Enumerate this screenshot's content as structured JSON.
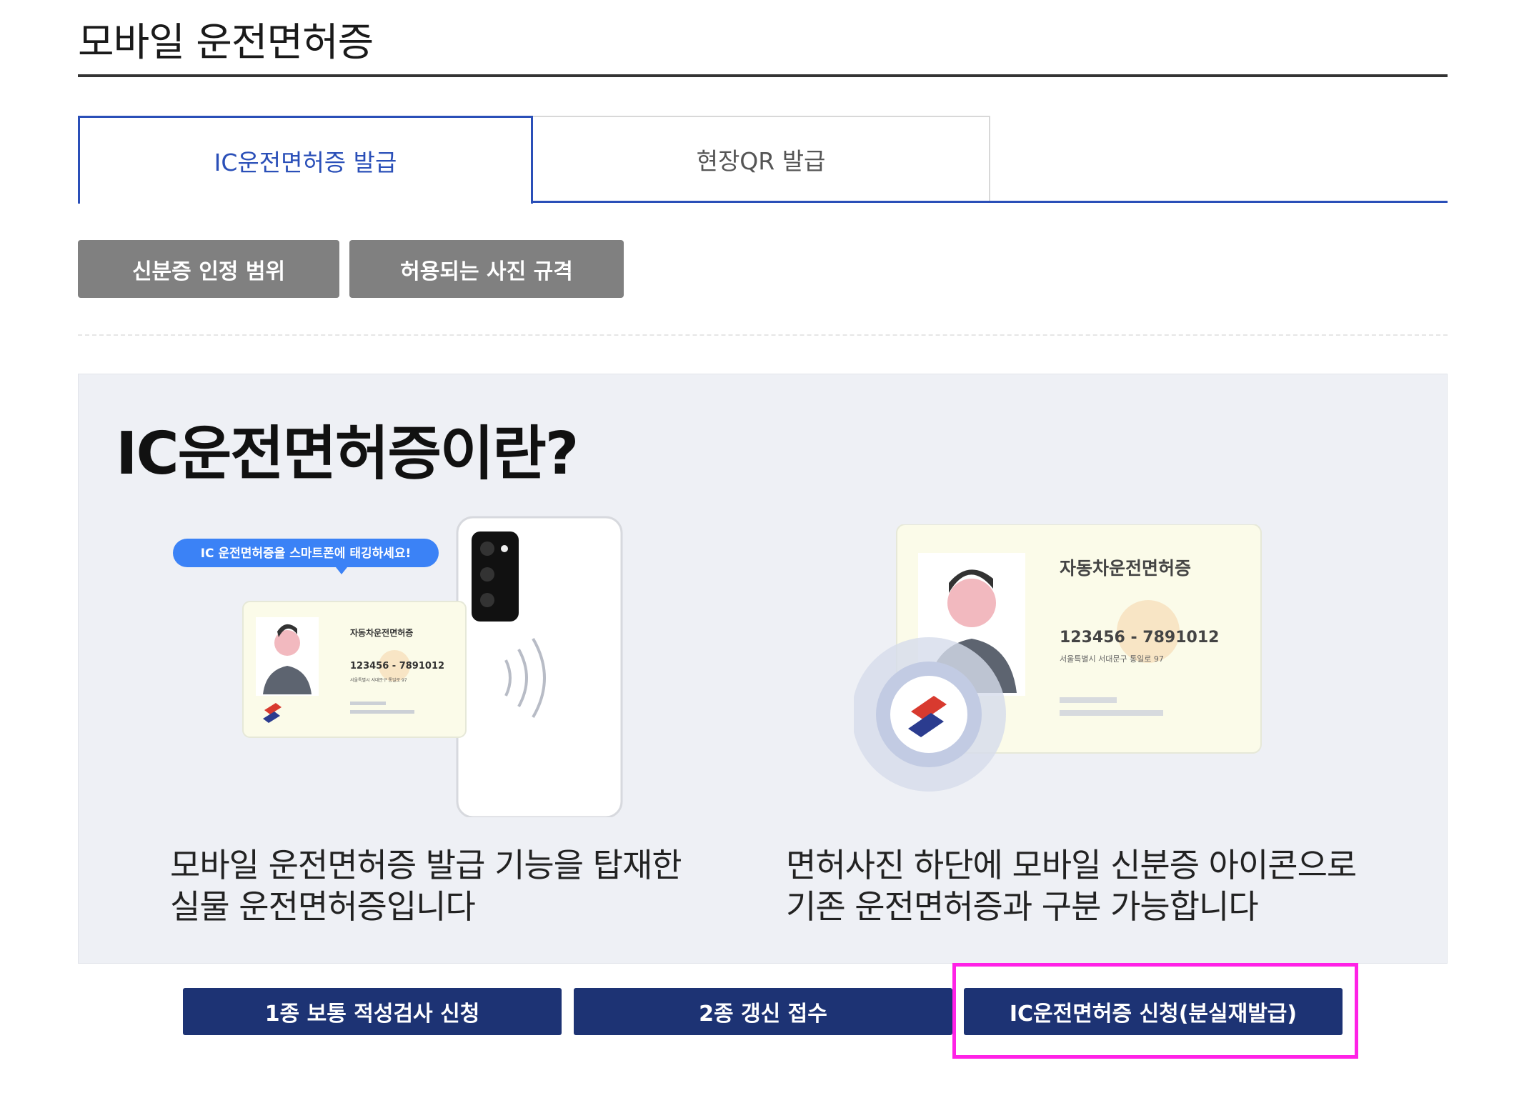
{
  "header": {
    "title": "모바일 운전면허증"
  },
  "tabs": [
    {
      "label": "IC운전면허증 발급",
      "active": true
    },
    {
      "label": "현장QR 발급",
      "active": false
    }
  ],
  "info_buttons": {
    "id_scope": "신분증 인정 범위",
    "photo_spec": "허용되는 사진 규격"
  },
  "info": {
    "heading": "IC운전면허증이란?",
    "left_illustration": {
      "bubble": "IC 운전면허증을 스마트폰에 태깅하세요!",
      "card_title": "자동차운전면허증",
      "card_number": "123456 - 7891012",
      "card_address": "서울특별시 서대문구 통일로 97"
    },
    "right_illustration": {
      "card_title": "자동차운전면허증",
      "card_number": "123456 - 7891012",
      "card_address": "서울특별시 서대문구 통일로 97"
    },
    "left_caption": [
      "모바일 운전면허증 발급 기능을 탑재한",
      "실물 운전면허증입니다"
    ],
    "right_caption": [
      "면허사진 하단에 모바일 신분증 아이콘으로",
      "기존 운전면허증과 구분 가능합니다"
    ]
  },
  "actions": {
    "aptitude_test": "1종 보통 적성검사 신청",
    "renewal": "2종 갱신 접수",
    "ic_apply": "IC운전면허증 신청(분실재발급)"
  },
  "colors": {
    "tab_active": "#2a4fb8",
    "gray_button": "#808080",
    "navy_button": "#1d3374",
    "highlight": "#ff22e6",
    "info_bg": "#eef0f5"
  }
}
